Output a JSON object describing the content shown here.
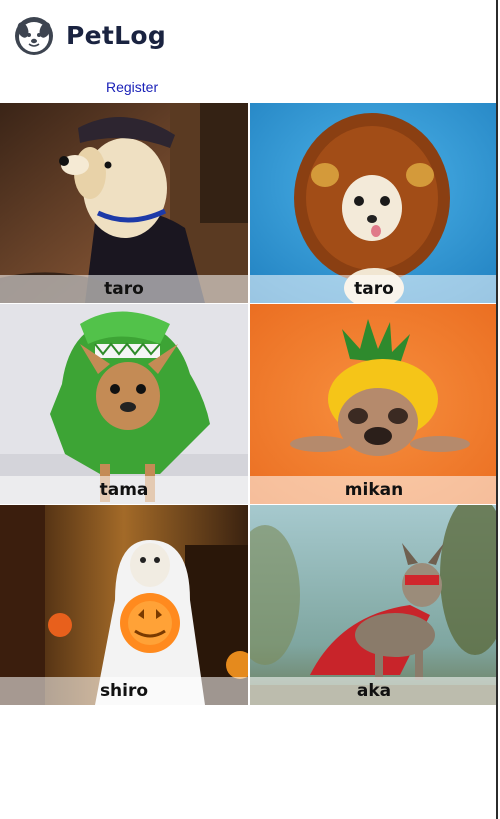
{
  "header": {
    "brand": "PetLog",
    "logo_icon": "dog-face-icon"
  },
  "nav": {
    "register_label": "Register"
  },
  "pets": [
    {
      "name": "taro",
      "photo": "dog-in-cap-photo",
      "bg": "#6b4a35"
    },
    {
      "name": "taro",
      "photo": "dog-lion-mane-photo",
      "bg": "#2f9ad8"
    },
    {
      "name": "tama",
      "photo": "dog-green-costume-photo",
      "bg": "#d9d9de"
    },
    {
      "name": "mikan",
      "photo": "dog-pineapple-photo",
      "bg": "#f07a2a"
    },
    {
      "name": "shiro",
      "photo": "dog-ghost-pumpkin-photo",
      "bg": "#4a2b15"
    },
    {
      "name": "aka",
      "photo": "dog-red-cape-photo",
      "bg": "#8fb3b8"
    }
  ],
  "colors": {
    "brand_text": "#1a2340",
    "link": "#1b22b8"
  }
}
